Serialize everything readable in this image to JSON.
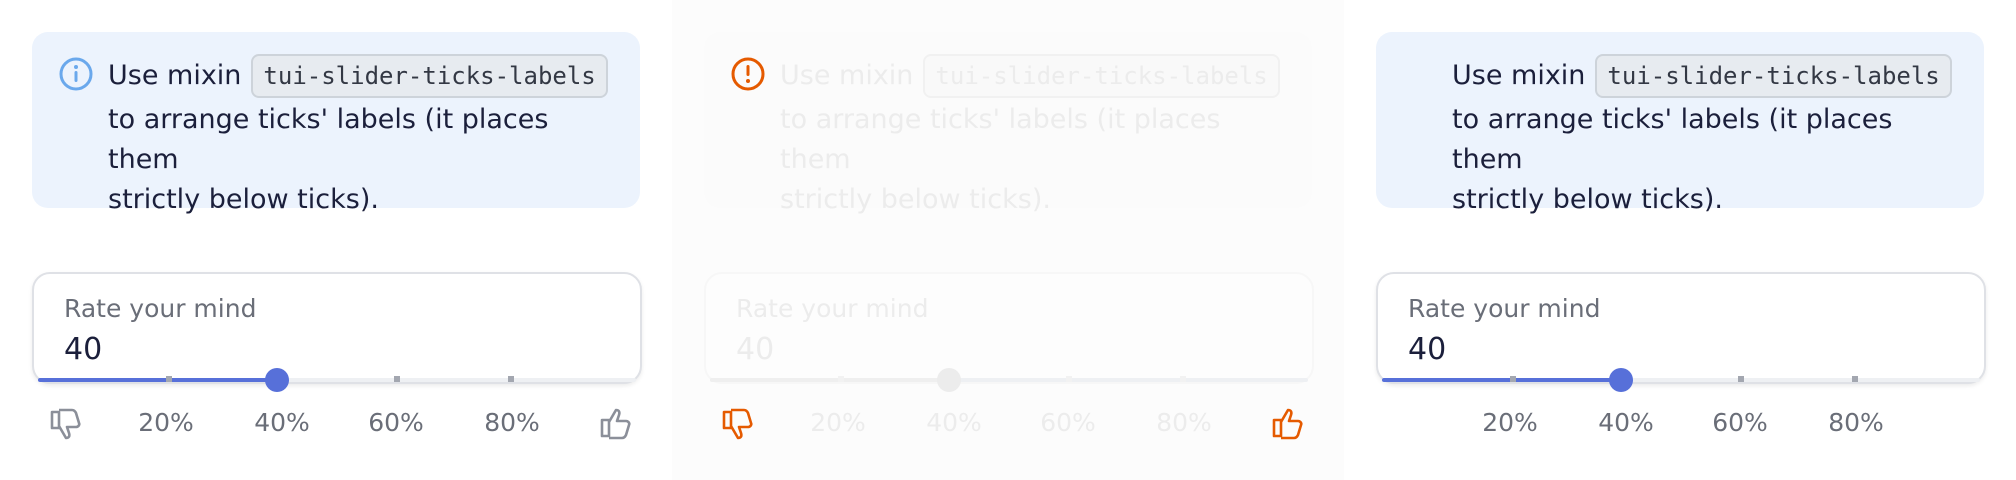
{
  "note": {
    "prefix": "Use mixin",
    "code": "tui-slider-ticks-labels",
    "line2": "to arrange ticks' labels (it places them",
    "line3": "strictly below ticks)."
  },
  "field": {
    "label": "Rate your mind",
    "value": "40"
  },
  "slider": {
    "value_percent": 40,
    "tick_labels": [
      "20%",
      "40%",
      "60%",
      "80%"
    ]
  },
  "colors": {
    "accent": "#5770d9",
    "info_blue": "#6aa8ec",
    "error_orange": "#e55a00",
    "icon_gray": "#8b8f99"
  },
  "icons": {
    "info": "info-icon",
    "dislike": "thumbs-down-icon",
    "like": "thumbs-up-icon"
  }
}
